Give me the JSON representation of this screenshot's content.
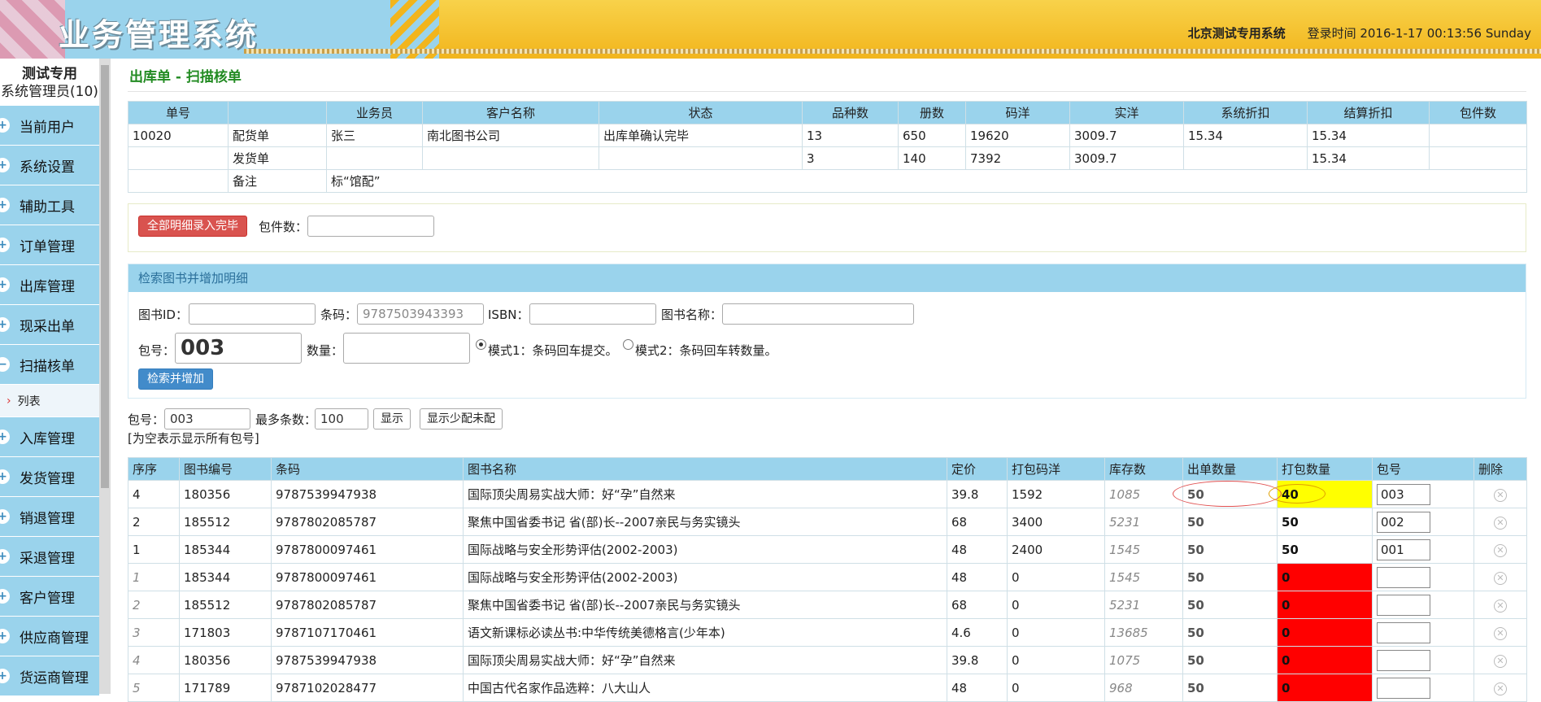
{
  "header": {
    "app_title": "业务管理系统",
    "system_name": "北京测试专用系统",
    "login_text": "登录时间 2016-1-17 00:13:56 Sunday"
  },
  "sidebar": {
    "user_name": "测试专用",
    "user_role": "系统管理员(10)",
    "items": [
      {
        "label": "当前用户",
        "icon": "plus"
      },
      {
        "label": "系统设置",
        "icon": "plus"
      },
      {
        "label": "辅助工具",
        "icon": "plus"
      },
      {
        "label": "订单管理",
        "icon": "plus"
      },
      {
        "label": "出库管理",
        "icon": "plus"
      },
      {
        "label": "现采出单",
        "icon": "plus"
      },
      {
        "label": "扫描核单",
        "icon": "minus"
      },
      {
        "label": "列表",
        "sub": true
      },
      {
        "label": "入库管理",
        "icon": "plus"
      },
      {
        "label": "发货管理",
        "icon": "plus"
      },
      {
        "label": "销退管理",
        "icon": "plus"
      },
      {
        "label": "采退管理",
        "icon": "plus"
      },
      {
        "label": "客户管理",
        "icon": "plus"
      },
      {
        "label": "供应商管理",
        "icon": "plus"
      },
      {
        "label": "货运商管理",
        "icon": "plus"
      }
    ]
  },
  "page": {
    "title": "出库单 - 扫描核单"
  },
  "summary": {
    "headers": [
      "单号",
      "",
      "业务员",
      "客户名称",
      "状态",
      "品种数",
      "册数",
      "码洋",
      "实洋",
      "系统折扣",
      "结算折扣",
      "包件数"
    ],
    "rows": [
      [
        "10020",
        "配货单",
        "张三",
        "南北图书公司",
        "出库单确认完毕",
        "13",
        "650",
        "19620",
        "3009.7",
        "15.34",
        "15.34",
        ""
      ],
      [
        "",
        "发货单",
        "",
        "",
        "",
        "3",
        "140",
        "7392",
        "3009.7",
        "",
        "15.34",
        ""
      ]
    ],
    "note_label": "备注",
    "note_value": "标“馆配”"
  },
  "finish": {
    "button": "全部明细录入完毕",
    "pkg_label": "包件数：",
    "pkg_value": ""
  },
  "search": {
    "panel_title": "检索图书并增加明细",
    "book_id_label": "图书ID：",
    "book_id_value": "",
    "barcode_label": "条码：",
    "barcode_placeholder": "9787503943393",
    "isbn_label": "ISBN：",
    "isbn_value": "",
    "name_label": "图书名称：",
    "name_value": "",
    "pkg_label": "包号：",
    "pkg_value": "003",
    "qty_label": "数量：",
    "qty_value": "",
    "mode1": "模式1：条码回车提交。",
    "mode2": "模式2：条码回车转数量。",
    "button": "检索并增加"
  },
  "filter": {
    "pkg_label": "包号：",
    "pkg_value": "003",
    "max_label": "最多条数：",
    "max_value": "100",
    "show_button": "显示",
    "show_less_button": "显示少配未配",
    "hint": "[为空表示显示所有包号]"
  },
  "detail": {
    "headers": [
      "序序",
      "图书编号",
      "条码",
      "图书名称",
      "定价",
      "打包码洋",
      "库存数",
      "出单数量",
      "打包数量",
      "包号",
      "删除"
    ],
    "rows": [
      {
        "seq": "4",
        "id": "180356",
        "barcode": "9787539947938",
        "name": "国际顶尖周易实战大师：好“孕”自然来",
        "price": "39.8",
        "pack_value": "1592",
        "stock": "1085",
        "out_qty": "50",
        "pack_qty": "40",
        "pkg": "003",
        "style": "yellow",
        "seq_italic": false
      },
      {
        "seq": "2",
        "id": "185512",
        "barcode": "9787802085787",
        "name": "聚焦中国省委书记 省(部)长--2007亲民与务实镜头",
        "price": "68",
        "pack_value": "3400",
        "stock": "5231",
        "out_qty": "50",
        "pack_qty": "50",
        "pkg": "002",
        "style": "",
        "seq_italic": false
      },
      {
        "seq": "1",
        "id": "185344",
        "barcode": "9787800097461",
        "name": "国际战略与安全形势评估(2002-2003)",
        "price": "48",
        "pack_value": "2400",
        "stock": "1545",
        "out_qty": "50",
        "pack_qty": "50",
        "pkg": "001",
        "style": "",
        "seq_italic": false
      },
      {
        "seq": "1",
        "id": "185344",
        "barcode": "9787800097461",
        "name": "国际战略与安全形势评估(2002-2003)",
        "price": "48",
        "pack_value": "0",
        "stock": "1545",
        "out_qty": "50",
        "pack_qty": "0",
        "pkg": "",
        "style": "red",
        "seq_italic": true
      },
      {
        "seq": "2",
        "id": "185512",
        "barcode": "9787802085787",
        "name": "聚焦中国省委书记 省(部)长--2007亲民与务实镜头",
        "price": "68",
        "pack_value": "0",
        "stock": "5231",
        "out_qty": "50",
        "pack_qty": "0",
        "pkg": "",
        "style": "red",
        "seq_italic": true
      },
      {
        "seq": "3",
        "id": "171803",
        "barcode": "9787107170461",
        "name": "语文新课标必读丛书:中华传统美德格言(少年本)",
        "price": "4.6",
        "pack_value": "0",
        "stock": "13685",
        "out_qty": "50",
        "pack_qty": "0",
        "pkg": "",
        "style": "red",
        "seq_italic": true
      },
      {
        "seq": "4",
        "id": "180356",
        "barcode": "9787539947938",
        "name": "国际顶尖周易实战大师：好“孕”自然来",
        "price": "39.8",
        "pack_value": "0",
        "stock": "1075",
        "out_qty": "50",
        "pack_qty": "0",
        "pkg": "",
        "style": "red",
        "seq_italic": true
      },
      {
        "seq": "5",
        "id": "171789",
        "barcode": "9787102028477",
        "name": "中国古代名家作品选粹：八大山人",
        "price": "48",
        "pack_value": "0",
        "stock": "968",
        "out_qty": "50",
        "pack_qty": "0",
        "pkg": "",
        "style": "red",
        "seq_italic": true
      }
    ]
  },
  "colors": {
    "accent_blue": "#9ad3ec",
    "highlight_yellow": "#ffff00",
    "alert_red": "#ff0000",
    "title_green": "#228b22"
  }
}
